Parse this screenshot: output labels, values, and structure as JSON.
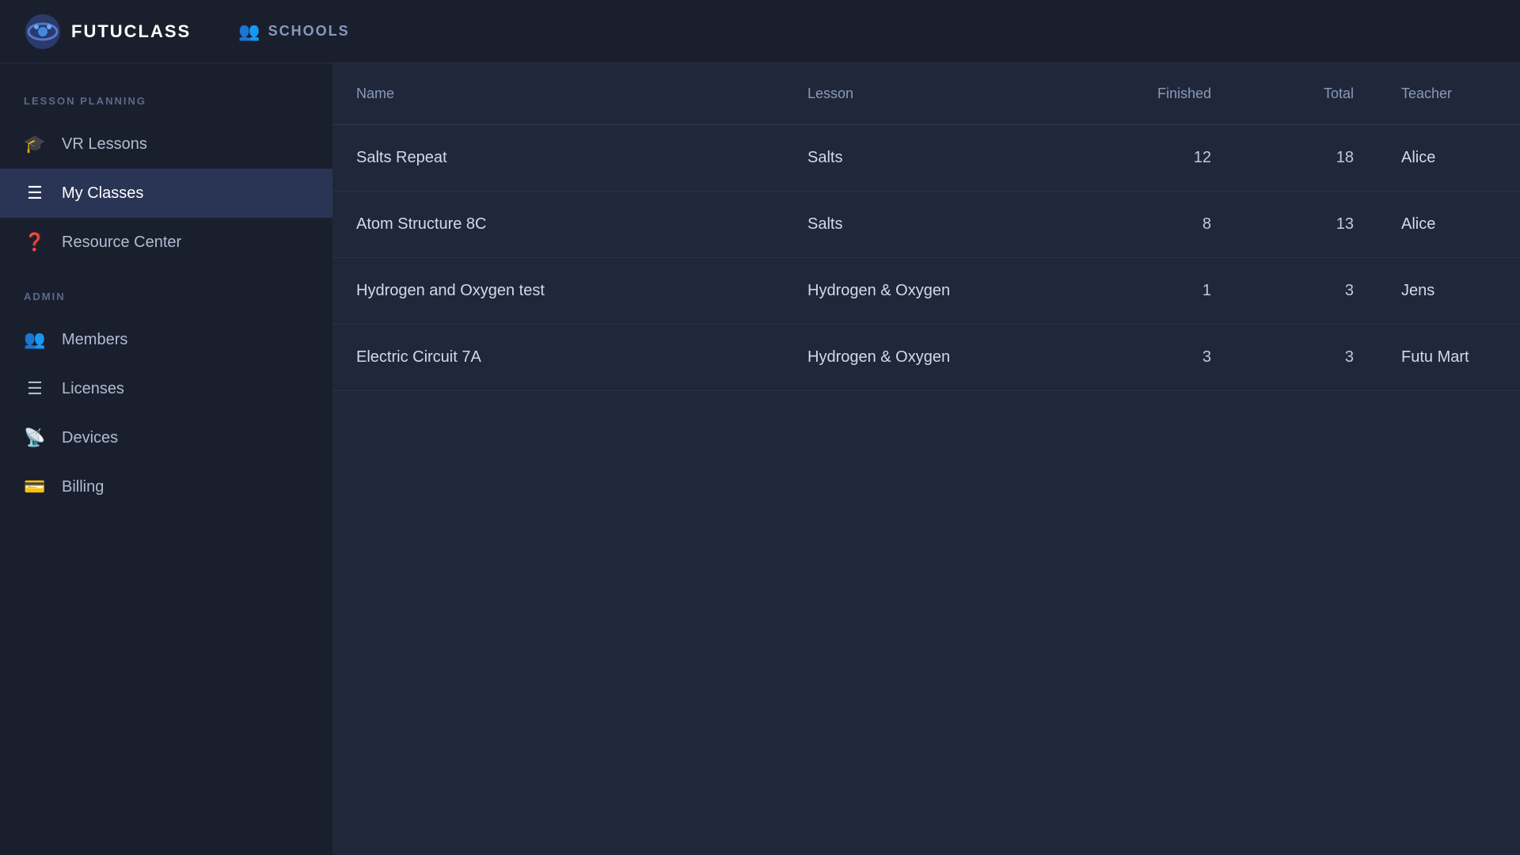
{
  "header": {
    "logo_text": "FUTUCLASS",
    "schools_label": "SCHOOLS"
  },
  "sidebar": {
    "lesson_planning_label": "LESSON PLANNING",
    "admin_label": "ADMIN",
    "nav_items_lesson": [
      {
        "id": "vr-lessons",
        "label": "VR Lessons",
        "icon": "🎓",
        "active": false
      },
      {
        "id": "my-classes",
        "label": "My Classes",
        "icon": "≡",
        "active": true
      },
      {
        "id": "resource-center",
        "label": "Resource Center",
        "icon": "❓",
        "active": false
      }
    ],
    "nav_items_admin": [
      {
        "id": "members",
        "label": "Members",
        "icon": "👥",
        "active": false
      },
      {
        "id": "licenses",
        "label": "Licenses",
        "icon": "☰",
        "active": false
      },
      {
        "id": "devices",
        "label": "Devices",
        "icon": "📡",
        "active": false
      },
      {
        "id": "billing",
        "label": "Billing",
        "icon": "💳",
        "active": false
      }
    ]
  },
  "table": {
    "columns": [
      {
        "id": "name",
        "label": "Name"
      },
      {
        "id": "lesson",
        "label": "Lesson"
      },
      {
        "id": "finished",
        "label": "Finished"
      },
      {
        "id": "total",
        "label": "Total"
      },
      {
        "id": "teacher",
        "label": "Teacher"
      }
    ],
    "rows": [
      {
        "name": "Salts Repeat",
        "lesson": "Salts",
        "finished": "12",
        "total": "18",
        "teacher": "Alice"
      },
      {
        "name": "Atom Structure 8C",
        "lesson": "Salts",
        "finished": "8",
        "total": "13",
        "teacher": "Alice"
      },
      {
        "name": "Hydrogen and Oxygen test",
        "lesson": "Hydrogen & Oxygen",
        "finished": "1",
        "total": "3",
        "teacher": "Jens"
      },
      {
        "name": "Electric Circuit 7A",
        "lesson": "Hydrogen & Oxygen",
        "finished": "3",
        "total": "3",
        "teacher": "Futu Mart"
      }
    ]
  }
}
